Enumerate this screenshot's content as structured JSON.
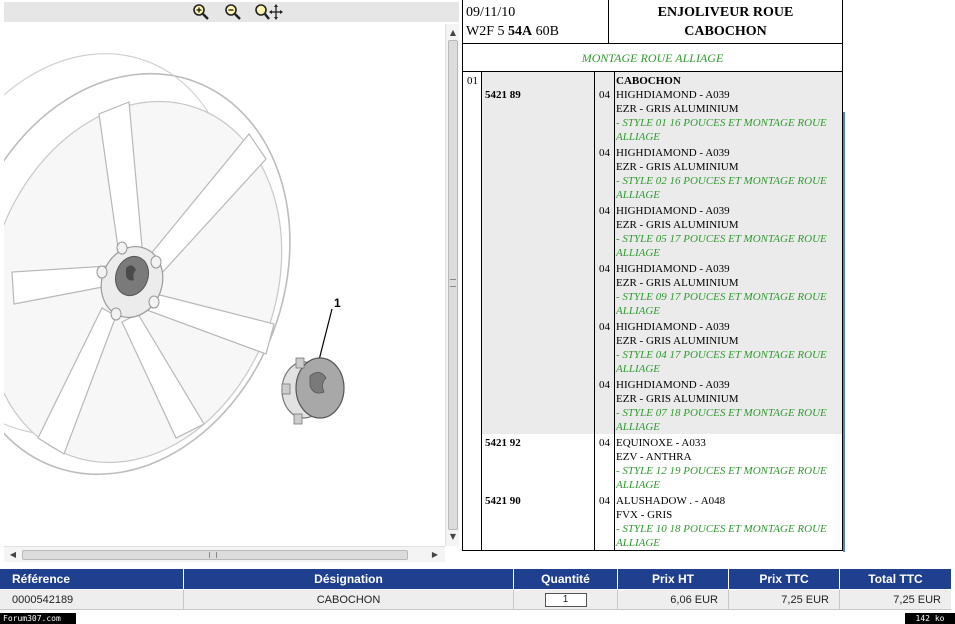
{
  "viewer": {
    "zoom_in_icon": "zoom-in-icon",
    "zoom_out_icon": "zoom-out-icon",
    "zoom_pan_icon": "zoom-pan-icon",
    "callout_label": "1"
  },
  "header": {
    "date": "09/11/10",
    "code": "W2F 5",
    "code_bold": "54A",
    "code_suffix": "60B",
    "title_line1": "ENJOLIVEUR ROUE",
    "title_line2": "CABOCHON",
    "subtitle": "MONTAGE ROUE ALLIAGE"
  },
  "parts": {
    "item_number": "01",
    "item_title": "CABOCHON",
    "groups": [
      {
        "ref": "5421 89",
        "variants": [
          {
            "qty": "04",
            "line1": "HIGHDIAMOND - A039",
            "line2": "EZR - GRIS ALUMINIUM",
            "note": "- STYLE 01 16 POUCES ET MONTAGE ROUE ALLIAGE"
          },
          {
            "qty": "04",
            "line1": "HIGHDIAMOND - A039",
            "line2": "EZR - GRIS ALUMINIUM",
            "note": "- STYLE 02 16 POUCES ET MONTAGE ROUE ALLIAGE"
          },
          {
            "qty": "04",
            "line1": "HIGHDIAMOND - A039",
            "line2": "EZR - GRIS ALUMINIUM",
            "note": "- STYLE 05 17 POUCES ET MONTAGE ROUE ALLIAGE"
          },
          {
            "qty": "04",
            "line1": "HIGHDIAMOND - A039",
            "line2": "EZR - GRIS ALUMINIUM",
            "note": "- STYLE 09 17 POUCES ET MONTAGE ROUE ALLIAGE"
          },
          {
            "qty": "04",
            "line1": "HIGHDIAMOND - A039",
            "line2": "EZR - GRIS ALUMINIUM",
            "note": "- STYLE 04 17 POUCES ET MONTAGE ROUE ALLIAGE"
          },
          {
            "qty": "04",
            "line1": "HIGHDIAMOND - A039",
            "line2": "EZR - GRIS ALUMINIUM",
            "note": "- STYLE 07 18 POUCES ET MONTAGE ROUE ALLIAGE"
          }
        ]
      },
      {
        "ref": "5421 92",
        "variants": [
          {
            "qty": "04",
            "line1": "EQUINOXE - A033",
            "line2": "EZV - ANTHRA",
            "note": "- STYLE 12 19 POUCES ET MONTAGE ROUE ALLIAGE"
          }
        ]
      },
      {
        "ref": "5421 90",
        "variants": [
          {
            "qty": "04",
            "line1": "ALUSHADOW . - A048",
            "line2": "FVX - GRIS",
            "note": "- STYLE 10 18 POUCES ET MONTAGE ROUE ALLIAGE"
          }
        ]
      }
    ]
  },
  "order_table": {
    "headers": {
      "reference": "Référence",
      "designation": "Désignation",
      "quantity": "Quantité",
      "price_ht": "Prix HT",
      "price_ttc": "Prix TTC",
      "total_ttc": "Total TTC"
    },
    "row": {
      "reference": "0000542189",
      "designation": "CABOCHON",
      "quantity": "1",
      "price_ht": "6,06 EUR",
      "price_ttc": "7,25 EUR",
      "total_ttc": "7,25 EUR"
    }
  },
  "status": {
    "left": "Forum307.com",
    "right": "142 ko"
  },
  "colors": {
    "header_blue": "#1f3f8f",
    "note_green": "#2e9a2e",
    "row_shade": "#ebebeb"
  }
}
